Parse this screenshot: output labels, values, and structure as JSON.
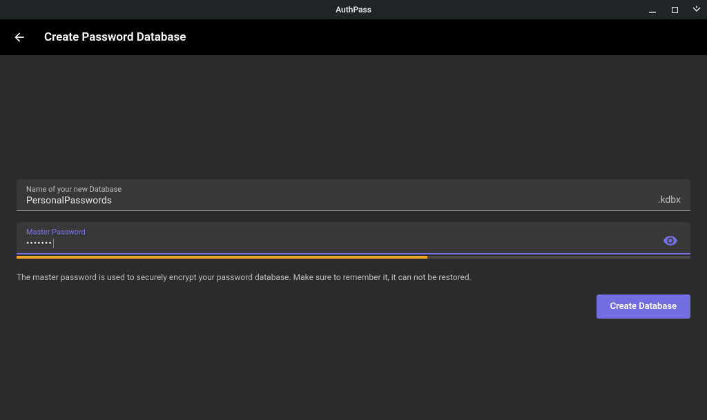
{
  "titlebar": {
    "title": "AuthPass"
  },
  "header": {
    "page_title": "Create Password Database"
  },
  "form": {
    "name_field": {
      "label": "Name of your new Database",
      "value": "PersonalPasswords",
      "suffix": ".kdbx"
    },
    "password_field": {
      "label": "Master Password",
      "value_masked": "•••••••"
    },
    "strength_percent": 61,
    "help_text": "The master password is used to securely encrypt your password database. Make sure to remember it, it can not be restored.",
    "create_button_label": "Create Database"
  }
}
